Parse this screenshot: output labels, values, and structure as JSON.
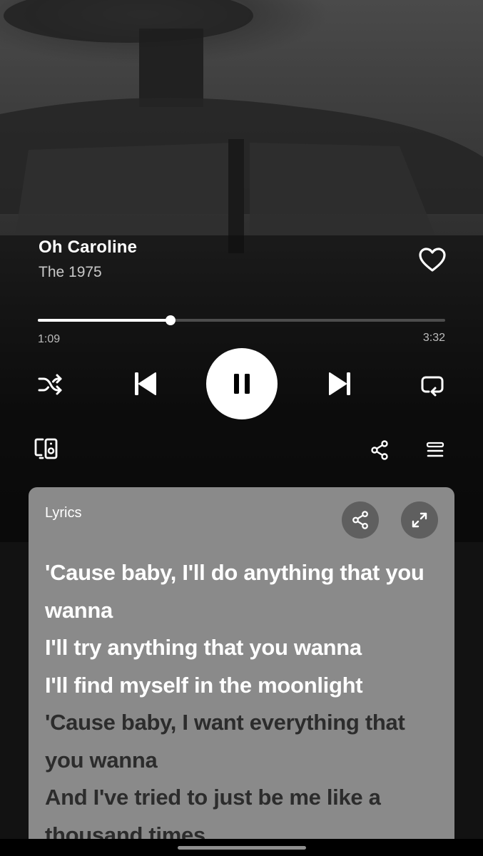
{
  "track": {
    "title": "Oh Caroline",
    "artist": "The 1975"
  },
  "playback": {
    "elapsed": "1:09",
    "duration": "3:32",
    "progress_fraction": 0.326,
    "state": "playing"
  },
  "icons": {
    "like": "heart-outline-icon",
    "shuffle": "shuffle-icon",
    "previous": "skip-previous-icon",
    "play_pause": "pause-icon",
    "next": "skip-next-icon",
    "repeat": "repeat-icon",
    "devices": "connect-devices-icon",
    "share": "share-icon",
    "queue": "queue-icon",
    "lyrics_share": "share-icon",
    "lyrics_expand": "expand-icon"
  },
  "lyrics": {
    "label": "Lyrics",
    "lines": [
      {
        "text": "'Cause baby, I'll do anything that you wanna",
        "state": "active"
      },
      {
        "text": "I'll try anything that you wanna",
        "state": "active"
      },
      {
        "text": "I'll find myself in the moonlight",
        "state": "active"
      },
      {
        "text": "'Cause baby, I want everything that you wanna",
        "state": "upcoming"
      },
      {
        "text": "And I've tried to just be me like a thousand times",
        "state": "upcoming"
      }
    ]
  },
  "colors": {
    "background": "#121212",
    "lyrics_card": "#8a8a8a",
    "lyric_active": "#ffffff",
    "lyric_upcoming": "#2c2c2c",
    "progress_track": "#4d4d4d"
  }
}
